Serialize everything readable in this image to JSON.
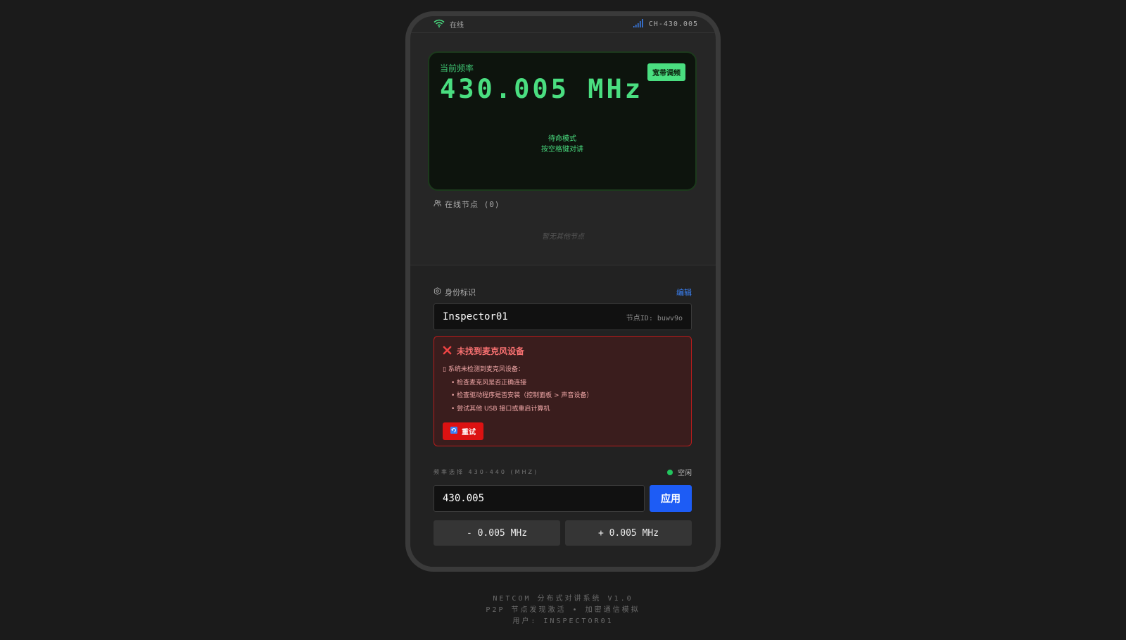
{
  "status": {
    "connection": "在线",
    "channel": "CH-430.005"
  },
  "display": {
    "current_label": "当前频率",
    "frequency": "430.005 MHz",
    "wideband_button": "宽带调频",
    "standby_line1": "待命模式",
    "standby_line2": "按空格键对讲"
  },
  "nodes": {
    "title": "在线节点 (0)",
    "empty": "暂无其他节点"
  },
  "identity": {
    "title": "身份标识",
    "edit": "编辑",
    "name": "Inspector01",
    "node_id": "节点ID: buwv9o"
  },
  "error": {
    "title": "未找到麦克风设备",
    "intro": "系统未检测到麦克风设备：",
    "items": [
      "• 检查麦克风是否正确连接",
      "• 检查驱动程序是否安装（控制面板 > 声音设备）",
      "• 尝试其他 USB 接口或重启计算机"
    ],
    "retry": "重试"
  },
  "freq_select": {
    "label": "频率选择 430-440 (MHZ)",
    "state": "空闲",
    "value": "430.005",
    "apply": "应用",
    "minus": "- 0.005 MHz",
    "plus": "+ 0.005 MHz"
  },
  "footer": {
    "line1": "NETCOM 分布式对讲系统 V1.0",
    "line2": "P2P 节点发现激活 • 加密通信模拟",
    "line3": "用户: INSPECTOR01"
  },
  "colors": {
    "accent_green": "#4ade80",
    "accent_blue": "#1d5cf5",
    "error_red": "#dc1212"
  }
}
